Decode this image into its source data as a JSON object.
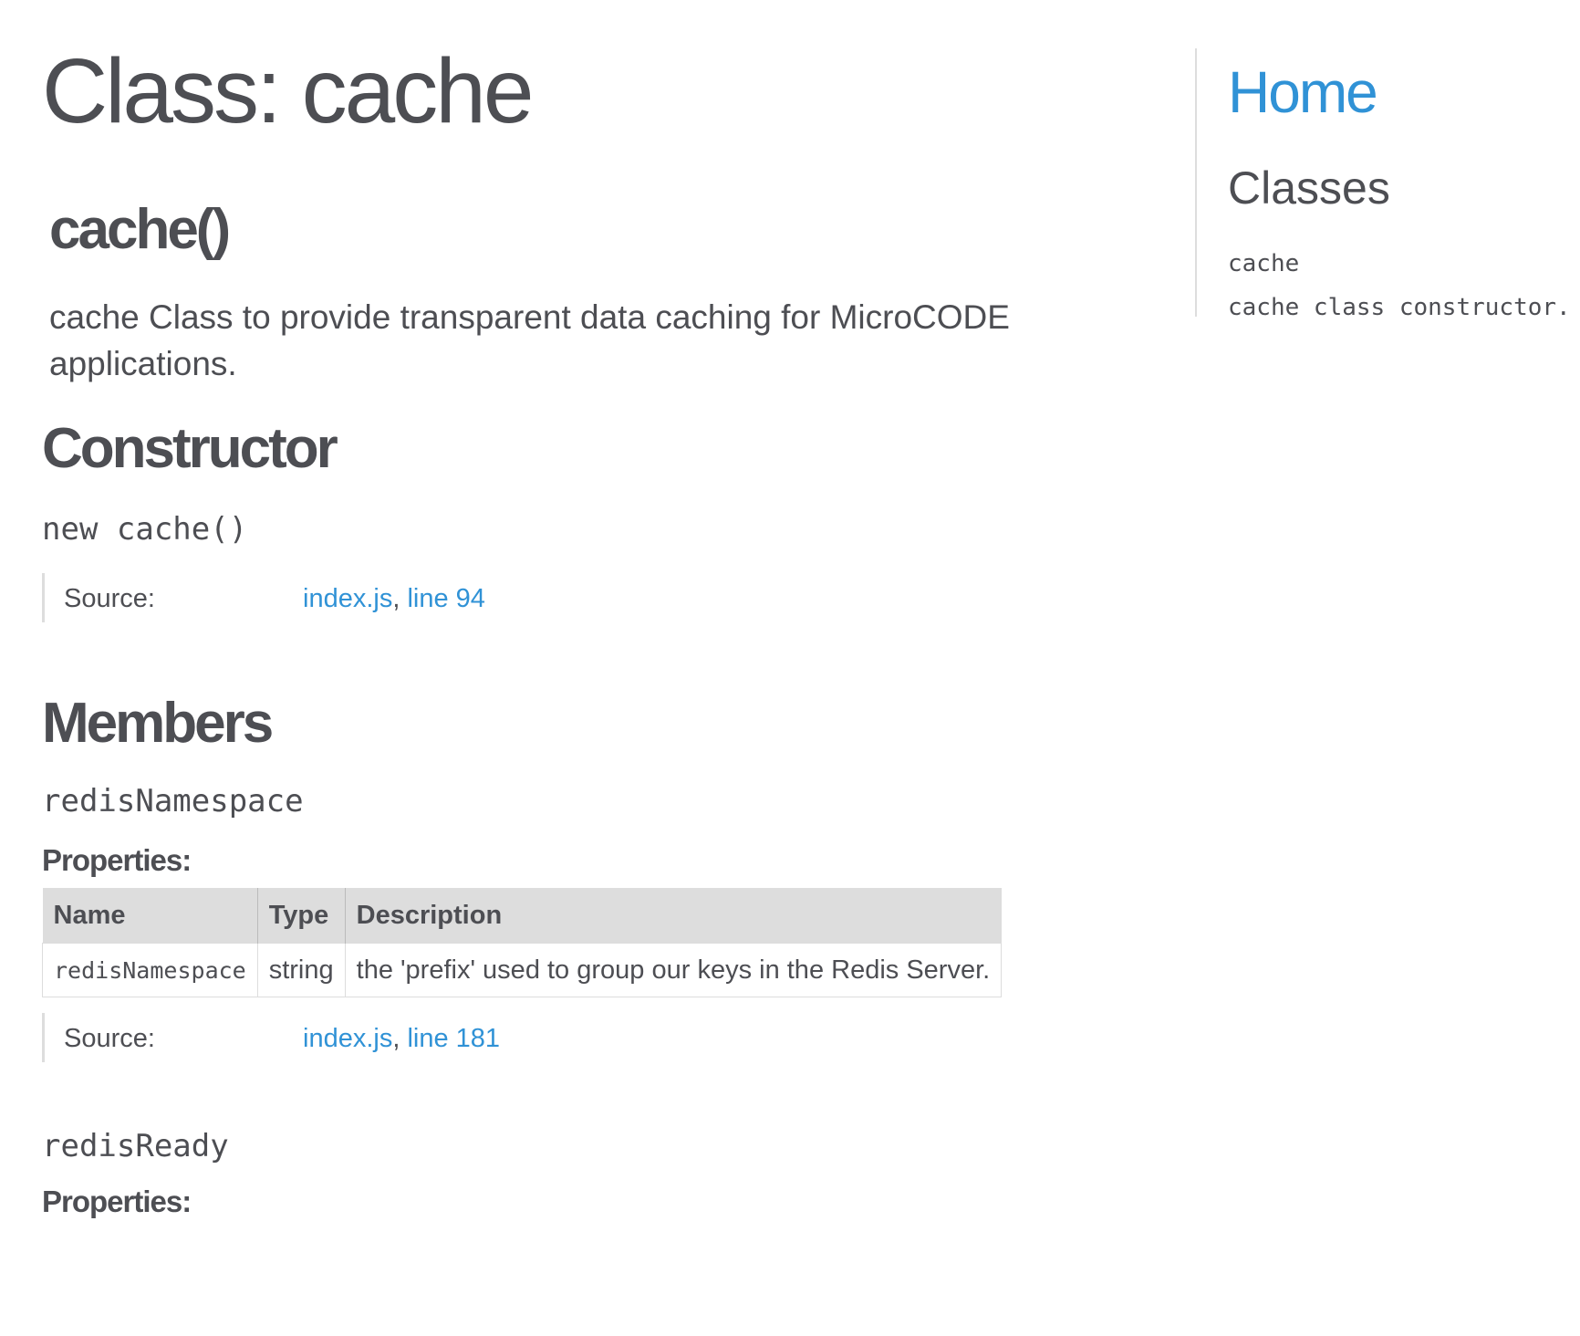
{
  "page_title": "Class: cache",
  "class_section": {
    "name": "cache()",
    "description": "cache Class to provide transparent data caching for MicroCODE applications."
  },
  "constructor": {
    "heading": "Constructor",
    "signature": "new cache()",
    "source_label": "Source:",
    "source_file": "index.js",
    "source_separator": ", ",
    "source_line": "line 94"
  },
  "members": {
    "heading": "Members",
    "items": [
      {
        "name": "redisNamespace",
        "properties_heading": "Properties:",
        "table_headers": [
          "Name",
          "Type",
          "Description"
        ],
        "rows": [
          {
            "name": "redisNamespace",
            "type": "string",
            "description": "the 'prefix' used to group our keys in the Redis Server."
          }
        ],
        "source_label": "Source:",
        "source_file": "index.js",
        "source_separator": ", ",
        "source_line": "line 181"
      },
      {
        "name": "redisReady",
        "properties_heading": "Properties:"
      }
    ]
  },
  "nav": {
    "home": "Home",
    "classes_heading": "Classes",
    "class_items": [
      "cache",
      "cache class constructor."
    ]
  },
  "colors": {
    "link": "#3092d6",
    "text": "#4d4e53",
    "table_header_bg": "#dddddd"
  }
}
